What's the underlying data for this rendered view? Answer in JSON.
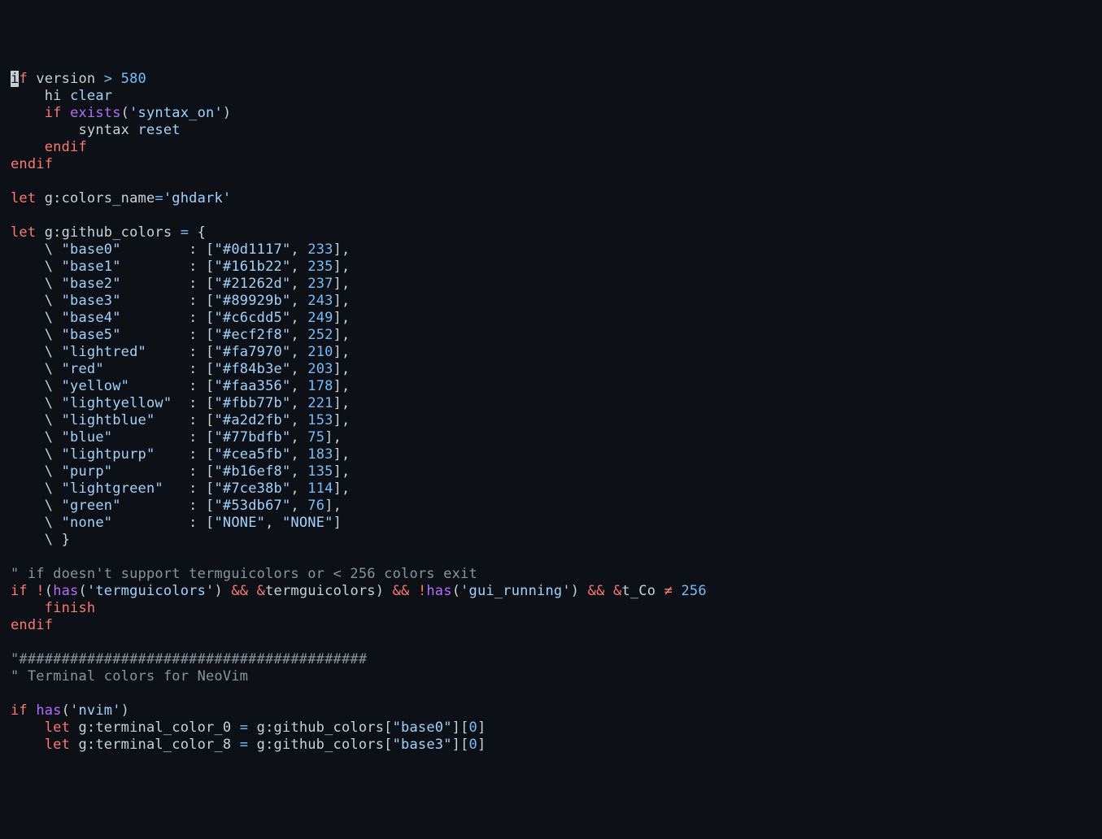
{
  "l1_if": "i",
  "l1_f": "f",
  "l1_version": "version",
  "l1_gt": ">",
  "l1_580": "580",
  "l2_hi": "hi",
  "l2_clear": "clear",
  "l3_if": "if",
  "l3_exists": "exists",
  "l3_s": "'syntax_on'",
  "l4_syntax": "syntax",
  "l4_reset": "reset",
  "l5_endif": "endif",
  "l6_endif": "endif",
  "l8_let": "let",
  "l8_var": "g:colors_name",
  "l8_eq": "=",
  "l8_val": "'ghdark'",
  "l10_let": "let",
  "l10_var": "g:github_colors",
  "l10_eq": "=",
  "l10_brace": "{",
  "colors": [
    {
      "key": "\"base0\"",
      "pad": "        ",
      "hex": "\"#0d1117\"",
      "num": "233",
      "trail": "],"
    },
    {
      "key": "\"base1\"",
      "pad": "        ",
      "hex": "\"#161b22\"",
      "num": "235",
      "trail": "],"
    },
    {
      "key": "\"base2\"",
      "pad": "        ",
      "hex": "\"#21262d\"",
      "num": "237",
      "trail": "],"
    },
    {
      "key": "\"base3\"",
      "pad": "        ",
      "hex": "\"#89929b\"",
      "num": "243",
      "trail": "],"
    },
    {
      "key": "\"base4\"",
      "pad": "        ",
      "hex": "\"#c6cdd5\"",
      "num": "249",
      "trail": "],"
    },
    {
      "key": "\"base5\"",
      "pad": "        ",
      "hex": "\"#ecf2f8\"",
      "num": "252",
      "trail": "],"
    },
    {
      "key": "\"lightred\"",
      "pad": "     ",
      "hex": "\"#fa7970\"",
      "num": "210",
      "trail": "],"
    },
    {
      "key": "\"red\"",
      "pad": "          ",
      "hex": "\"#f84b3e\"",
      "num": "203",
      "trail": "],"
    },
    {
      "key": "\"yellow\"",
      "pad": "       ",
      "hex": "\"#faa356\"",
      "num": "178",
      "trail": "],"
    },
    {
      "key": "\"lightyellow\"",
      "pad": "  ",
      "hex": "\"#fbb77b\"",
      "num": "221",
      "trail": "],"
    },
    {
      "key": "\"lightblue\"",
      "pad": "    ",
      "hex": "\"#a2d2fb\"",
      "num": "153",
      "trail": "],"
    },
    {
      "key": "\"blue\"",
      "pad": "         ",
      "hex": "\"#77bdfb\"",
      "num": "75",
      "trail": "],"
    },
    {
      "key": "\"lightpurp\"",
      "pad": "    ",
      "hex": "\"#cea5fb\"",
      "num": "183",
      "trail": "],"
    },
    {
      "key": "\"purp\"",
      "pad": "         ",
      "hex": "\"#b16ef8\"",
      "num": "135",
      "trail": "],"
    },
    {
      "key": "\"lightgreen\"",
      "pad": "   ",
      "hex": "\"#7ce38b\"",
      "num": "114",
      "trail": "],"
    },
    {
      "key": "\"green\"",
      "pad": "        ",
      "hex": "\"#53db67\"",
      "num": "76",
      "trail": "],"
    }
  ],
  "none_key": "\"none\"",
  "none_pad": "         ",
  "none_hex": "\"NONE\"",
  "none_num": "\"NONE\"",
  "none_trail": "]",
  "close_brace": "}",
  "cm1": "\" if doesn't support termguicolors or < 256 colors exit",
  "l_if": "if",
  "l_bang": "!",
  "l_has1": "has",
  "l_s1": "'termguicolors'",
  "l_amp1": "&&",
  "l_amp2": "&",
  "l_tg": "termguicolors",
  "l_amp3": "&&",
  "l_bang2": "!",
  "l_has2": "has",
  "l_s2": "'gui_running'",
  "l_amp4": "&&",
  "l_amp5": "&",
  "l_tco": "t_Co",
  "l_neq": "≠",
  "l_256": "256",
  "finish": "finish",
  "endif2": "endif",
  "cm2": "\"#########################################",
  "cm3": "\" Terminal colors for NeoVim",
  "l_if2": "if",
  "l_has3": "has",
  "l_s3": "'nvim'",
  "tc0_let": "let",
  "tc0_var": "g:terminal_color_0",
  "tc0_eq": "=",
  "tc0_src": "g:github_colors",
  "tc0_key": "\"base0\"",
  "tc0_idx": "0",
  "tc8_let": "let",
  "tc8_var": "g:terminal_color_8",
  "tc8_eq": "=",
  "tc8_src": "g:github_colors",
  "tc8_key": "\"base3\"",
  "tc8_idx": "0"
}
